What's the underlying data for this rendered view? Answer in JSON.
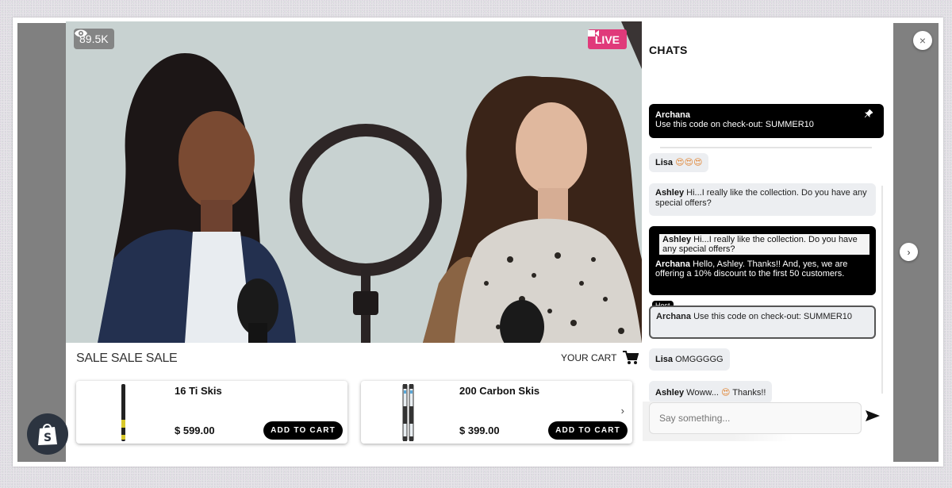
{
  "stream": {
    "viewer_count": "89.5K",
    "live_label": "LIVE",
    "icons": {
      "viewers": "eye-icon",
      "live": "video-camera-icon"
    }
  },
  "shop": {
    "sale_title": "SALE SALE SALE",
    "cart_label": "YOUR CART",
    "cart_icon": "shopping-cart-icon",
    "products": [
      {
        "name": "16 Ti Skis",
        "price": "$ 599.00",
        "button": "ADD TO CART"
      },
      {
        "name": "200 Carbon Skis",
        "price": "$ 399.00",
        "button": "ADD TO CART"
      }
    ]
  },
  "chat": {
    "title": "CHATS",
    "pinned": {
      "author": "Archana",
      "text": "Use this code on check-out: SUMMER10",
      "icon": "pin-icon"
    },
    "messages": [
      {
        "author": "Lisa",
        "text": "😍😍😍"
      },
      {
        "author": "Ashley",
        "text": "Hi...I really like the collection. Do you have any special offers?"
      },
      {
        "quote_author": "Ashley",
        "quote_text": "Hi...I really like the collection. Do you have any special offers?",
        "author": "Archana",
        "text": "Hello, Ashley. Thanks!! And, yes, we are offering a 10% discount to the first 50 customers."
      },
      {
        "tag": "Host",
        "author": "Archana",
        "text": "Use this code on check-out: SUMMER10"
      },
      {
        "author": "Lisa",
        "text": "OMGGGGG"
      },
      {
        "author": "Ashley",
        "text_before": "Woww...",
        "emoji": "😍",
        "text_after": "Thanks!!"
      }
    ],
    "input_placeholder": "Say something...",
    "send_icon": "send-icon"
  },
  "controls": {
    "close": "×",
    "next": "›",
    "product_next": "›"
  },
  "colors": {
    "live": "#e03a7a",
    "overlay_gray": "#808080",
    "shopify_badge": "#2c3440"
  }
}
